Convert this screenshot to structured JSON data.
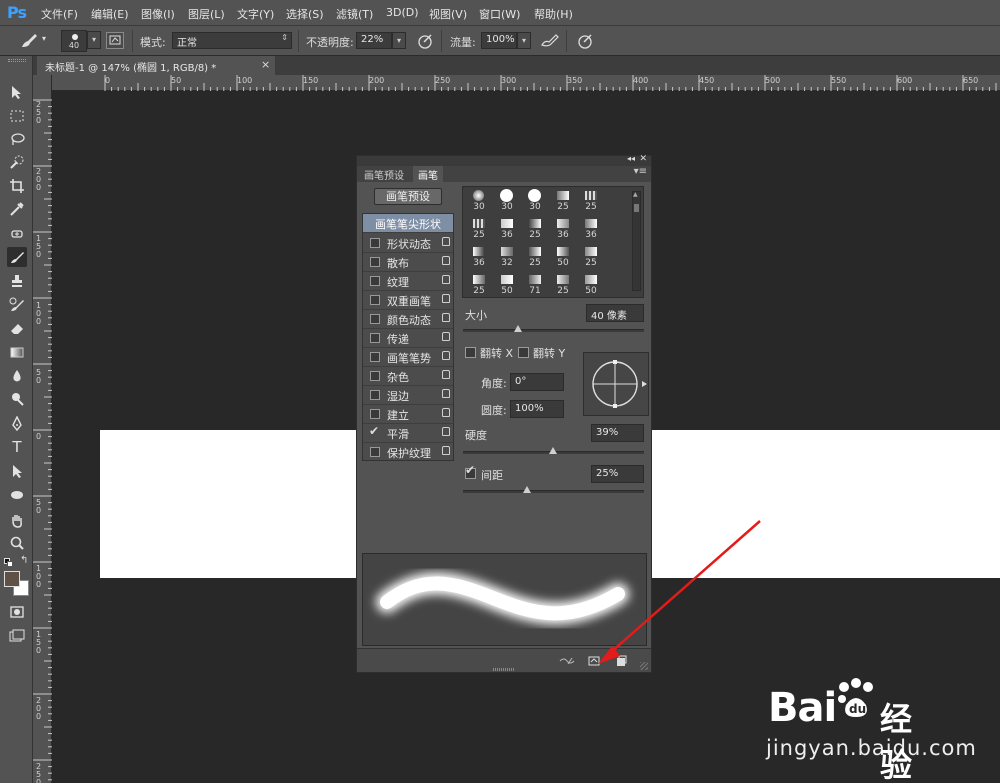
{
  "app": {
    "logo": "Ps"
  },
  "menu": [
    "文件(F)",
    "编辑(E)",
    "图像(I)",
    "图层(L)",
    "文字(Y)",
    "选择(S)",
    "滤镜(T)",
    "3D(D)",
    "视图(V)",
    "窗口(W)",
    "帮助(H)"
  ],
  "options": {
    "brush_size": "40",
    "mode_label": "模式:",
    "mode_value": "正常",
    "opacity_label": "不透明度:",
    "opacity_value": "22%",
    "flow_label": "流量:",
    "flow_value": "100%"
  },
  "document": {
    "tab_title": "未标题-1 @ 147% (椭圆 1, RGB/8) *",
    "close": "×"
  },
  "ruler_top": [
    "0",
    "50",
    "100",
    "150",
    "200",
    "250",
    "300",
    "350",
    "400",
    "450",
    "500",
    "550",
    "600",
    "650"
  ],
  "ruler_left": [
    "250",
    "200",
    "150",
    "100",
    "50",
    "0",
    "50",
    "100",
    "150",
    "200",
    "250"
  ],
  "panel": {
    "tabs": [
      "画笔预设",
      "画笔"
    ],
    "active_tab": "画笔",
    "preset_button": "画笔预设",
    "options": [
      {
        "label": "画笔笔尖形状",
        "checked": false,
        "highlighted": true
      },
      {
        "label": "形状动态",
        "checked": false
      },
      {
        "label": "散布",
        "checked": false
      },
      {
        "label": "纹理",
        "checked": false
      },
      {
        "label": "双重画笔",
        "checked": false
      },
      {
        "label": "颜色动态",
        "checked": false
      },
      {
        "label": "传递",
        "checked": false
      },
      {
        "label": "画笔笔势",
        "checked": false
      },
      {
        "label": "杂色",
        "checked": false
      },
      {
        "label": "湿边",
        "checked": false
      },
      {
        "label": "建立",
        "checked": false
      },
      {
        "label": "平滑",
        "checked": true
      },
      {
        "label": "保护纹理",
        "checked": false
      }
    ],
    "brush_sizes": [
      "30",
      "30",
      "30",
      "25",
      "25",
      "25",
      "36",
      "25",
      "36",
      "36",
      "36",
      "32",
      "25",
      "50",
      "25",
      "25",
      "50",
      "71",
      "25",
      "50"
    ],
    "size_label": "大小",
    "size_value": "40 像素",
    "flip_x": "翻转 X",
    "flip_y": "翻转 Y",
    "angle_label": "角度:",
    "angle_value": "0°",
    "roundness_label": "圆度:",
    "roundness_value": "100%",
    "hardness_label": "硬度",
    "hardness_value": "39%",
    "spacing_label": "间距",
    "spacing_value": "25%",
    "spacing_checked": true,
    "hardness_level": 0.39,
    "spacing_level": 0.25,
    "size_level": 0.2
  },
  "watermark": {
    "brand": "Bai",
    "brand2": "经验",
    "url": "jingyan.baidu.com"
  },
  "colors": {
    "accent": "#7d8ea5",
    "ps_blue": "#3ea0ff",
    "arrow": "#e31b1b"
  }
}
